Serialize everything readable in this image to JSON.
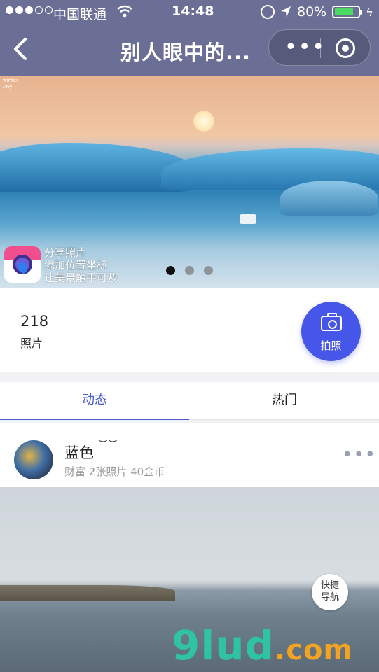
{
  "status_bar": {
    "carrier": "中国联通",
    "time": "14:48",
    "battery": "80%",
    "battery_level": 0.8
  },
  "nav": {
    "title": "别人眼中的...",
    "more_label": "•••"
  },
  "banner": {
    "corner_text": [
      "winter",
      "Any"
    ],
    "promo_lines": [
      "分享照片",
      "添加位置坐标",
      "让美景触手可及"
    ],
    "page_count": 3,
    "active_page": 1
  },
  "photos": {
    "count": "218",
    "label": "照片",
    "shoot_label": "拍照"
  },
  "tabs": [
    {
      "label": "动态",
      "active": true
    },
    {
      "label": "热门",
      "active": false
    }
  ],
  "post": {
    "username": "蓝色",
    "username_ornament": "︶︶",
    "meta": "财富 2张照片 40金币",
    "more_label": "•••"
  },
  "quick_nav": {
    "line1": "快捷",
    "line2": "导航"
  },
  "watermark": {
    "brand": "9lud",
    "suffix": ".com"
  },
  "colors": {
    "nav_bg": "#6b6f96",
    "accent": "#4a5bd6",
    "shoot_button": "#4556e8",
    "watermark_green": "#2fc2a4",
    "watermark_orange": "#f3a221"
  }
}
